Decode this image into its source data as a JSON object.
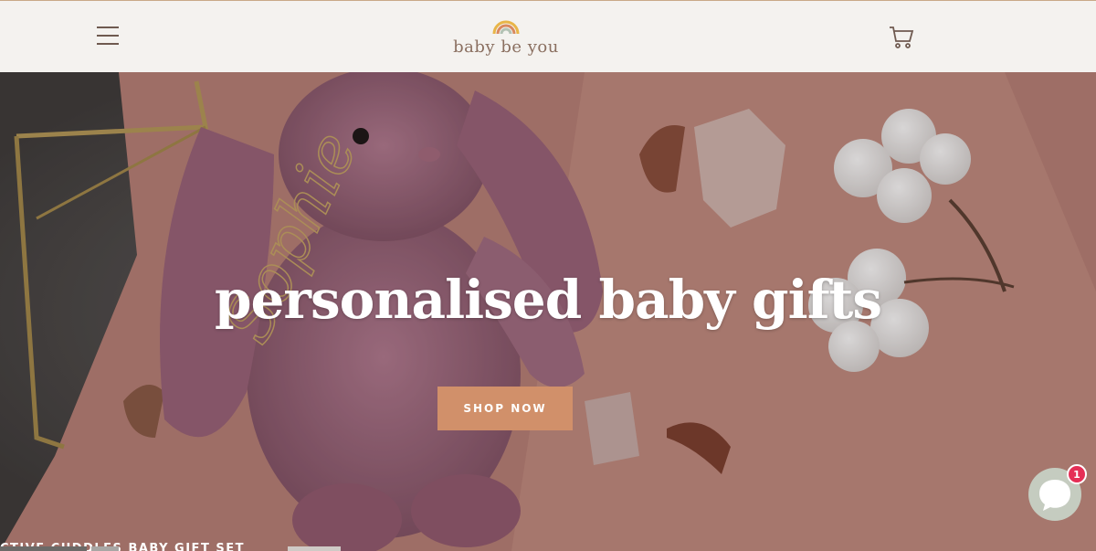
{
  "header": {
    "brand": "baby be you",
    "menu_icon": "hamburger-menu-icon",
    "cart_icon": "shopping-cart-icon",
    "logo_icon": "rainbow-logo-icon"
  },
  "hero": {
    "headline": "personalised baby gifts",
    "cta_label": "SHOP NOW",
    "name_script": "Sophie",
    "bottom_caption": "CTIVE CUDDLES BABY GIFT SET"
  },
  "chat": {
    "icon": "chat-bubble-icon",
    "badge_count": "1"
  },
  "colors": {
    "header_bg": "#f4f2ef",
    "brand_text": "#8a6f60",
    "cta_bg": "#d1906a",
    "badge_bg": "#e52f56",
    "chat_bg": "#c5ccc0"
  }
}
